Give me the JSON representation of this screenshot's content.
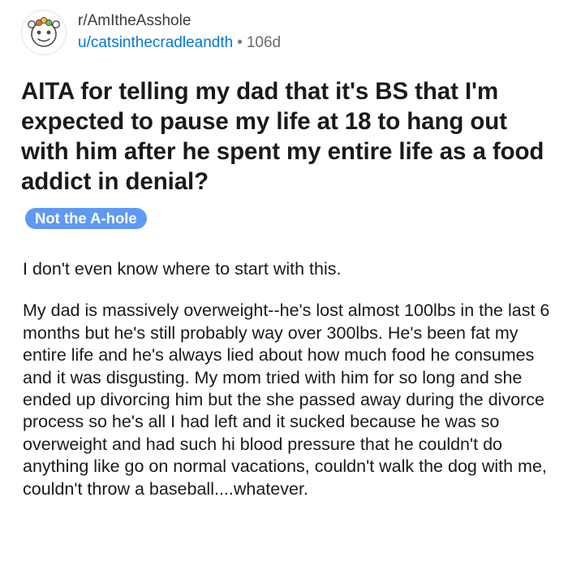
{
  "post": {
    "subreddit": "r/AmItheAsshole",
    "author": "u/catsinthecradleandth",
    "separator": "•",
    "age": "106d",
    "avatar_icon": "subreddit-mascot-icon",
    "title": "AITA for telling my dad that it's BS that I'm expected to pause my life at 18 to hang out with him after he spent my entire life as a food addict in denial?",
    "flair": {
      "label": "Not the A-hole",
      "color": "#5f99f5"
    },
    "body": [
      "I don't even know where to start with this.",
      "My dad is massively overweight--he's lost almost 100lbs in the last 6 months but he's still probably way over 300lbs. He's been fat my entire life and he's always lied about how much food he consumes and it was disgusting. My mom tried with him for so long and she ended up divorcing him but the she passed away during the divorce process so he's all I had left and it sucked because he was so overweight and had such hi blood pressure that he couldn't do anything like go on normal vacations, couldn't walk the dog with me, couldn't throw a baseball....whatever."
    ]
  },
  "colors": {
    "link": "#0079d3",
    "text": "#1a1a1b",
    "muted": "#6b6b6b"
  }
}
